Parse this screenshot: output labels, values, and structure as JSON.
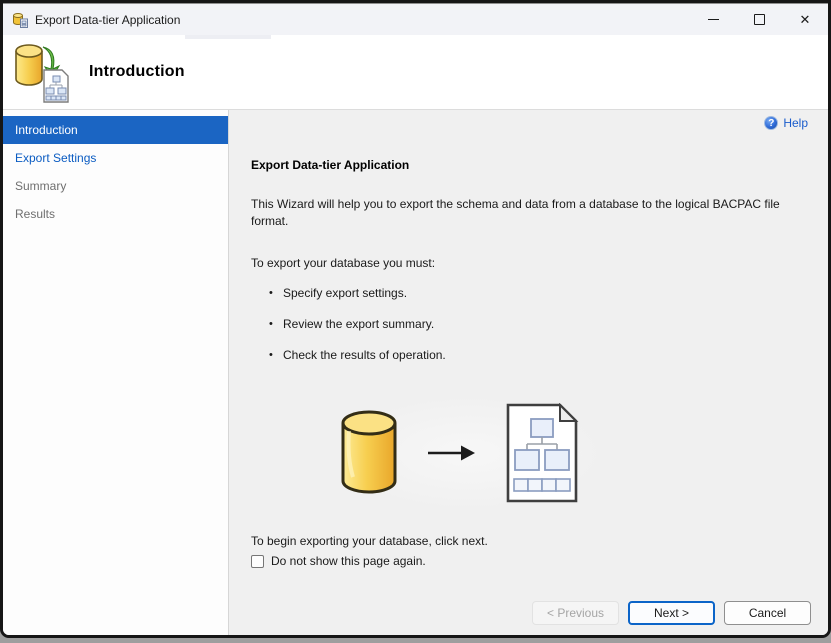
{
  "window": {
    "title": "Export Data-tier Application",
    "controls": {
      "close_glyph": "✕"
    }
  },
  "header": {
    "title": "Introduction"
  },
  "sidebar": {
    "items": [
      {
        "label": "Introduction",
        "state": "selected"
      },
      {
        "label": "Export Settings",
        "state": "link"
      },
      {
        "label": "Summary",
        "state": "disabled"
      },
      {
        "label": "Results",
        "state": "disabled"
      }
    ]
  },
  "main": {
    "help_label": "Help",
    "help_glyph": "?",
    "heading": "Export Data-tier Application",
    "intro_paragraph": "This Wizard will help you to export the schema and data from a database to the logical BACPAC file format.",
    "list_intro": "To export your database you must:",
    "bullet_glyph": "•",
    "bullets": [
      "Specify export settings.",
      "Review the export summary.",
      "Check the results of operation."
    ],
    "note": "To begin exporting your database, click next.",
    "checkbox_label": "Do not show this page again.",
    "checkbox_checked": false
  },
  "footer": {
    "previous_label": "< Previous",
    "next_label": "Next >",
    "cancel_label": "Cancel"
  },
  "colors": {
    "selected_nav_blue": "#1b65c3",
    "link_blue": "#0b5cc2",
    "help_blue": "#1a5ccc",
    "next_button_border": "#0b64c8",
    "titlebar_bg": "#f2f3f7",
    "main_bg": "#f0f0f0",
    "db_cylinder_yellow": "#f2c339"
  }
}
